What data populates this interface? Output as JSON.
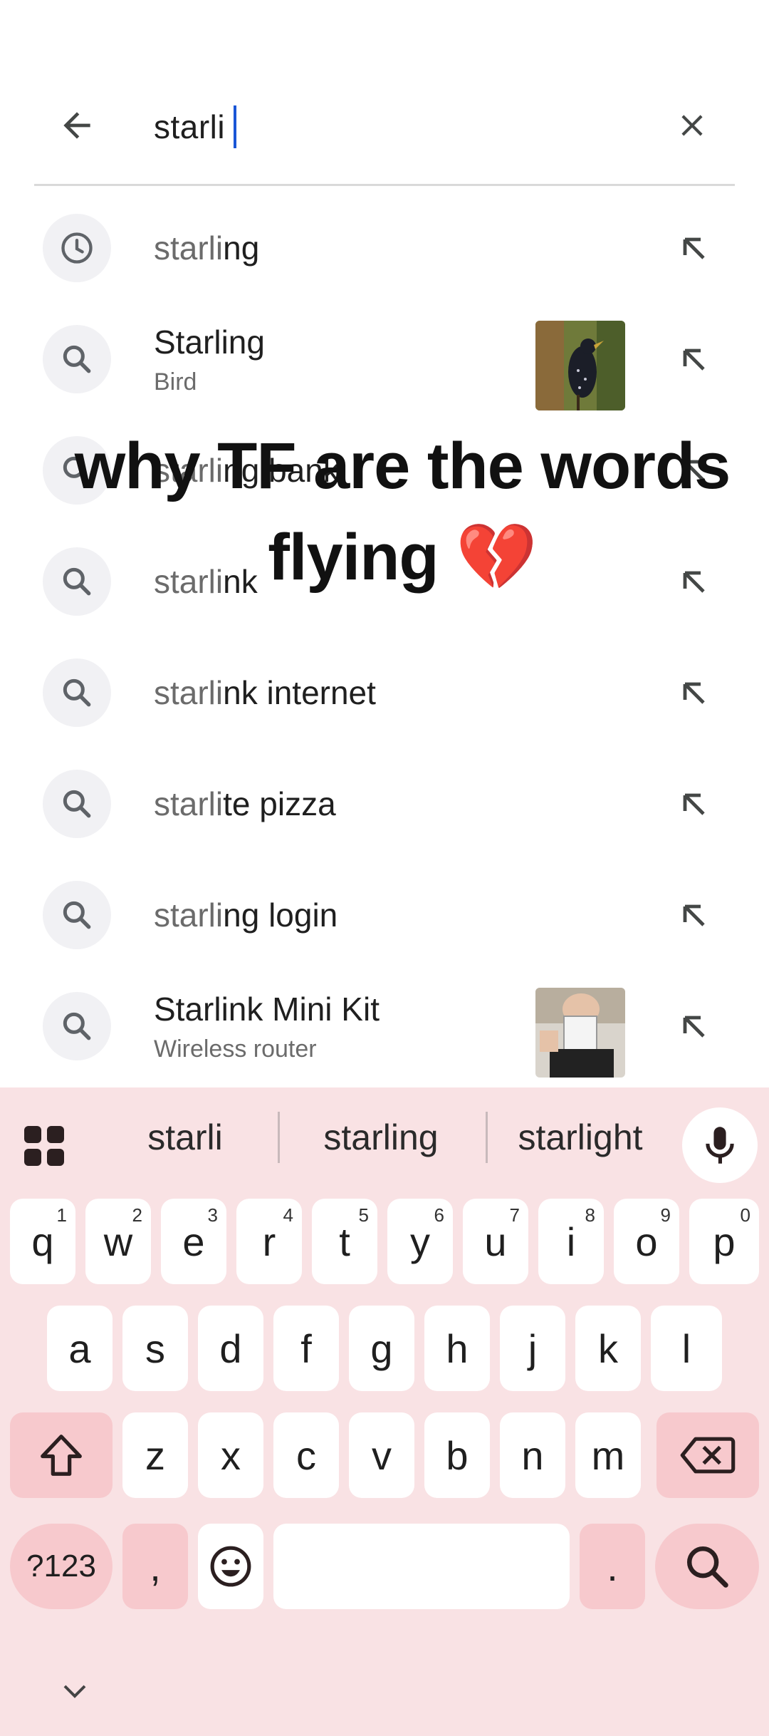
{
  "search": {
    "query": "starli",
    "back_icon": "arrow-back-icon",
    "clear_icon": "close-icon"
  },
  "suggestions": [
    {
      "type": "history",
      "icon": "history-icon",
      "typed": "starli",
      "rest": "ng"
    },
    {
      "type": "entity",
      "icon": "search-icon",
      "title": "Starling",
      "subtitle": "Bird",
      "thumb": "starling-bird-photo"
    },
    {
      "type": "query",
      "icon": "search-icon",
      "typed": "starli",
      "rest": "ng bank"
    },
    {
      "type": "query",
      "icon": "search-icon",
      "typed": "starli",
      "rest": "nk"
    },
    {
      "type": "query",
      "icon": "search-icon",
      "typed": "starli",
      "rest": "nk internet"
    },
    {
      "type": "query",
      "icon": "search-icon",
      "typed": "starli",
      "rest": "te pizza"
    },
    {
      "type": "query",
      "icon": "search-icon",
      "typed": "starli",
      "rest": "ng login"
    },
    {
      "type": "entity",
      "icon": "search-icon",
      "title": "Starlink Mini Kit",
      "subtitle": "Wireless router",
      "thumb": "router-kit-photo"
    }
  ],
  "overlay": {
    "line1": "why TF are the words",
    "line2": "flying 💔"
  },
  "keyboard": {
    "predictions": [
      "starli",
      "starling",
      "starlight"
    ],
    "row1": [
      {
        "k": "q",
        "h": "1"
      },
      {
        "k": "w",
        "h": "2"
      },
      {
        "k": "e",
        "h": "3"
      },
      {
        "k": "r",
        "h": "4"
      },
      {
        "k": "t",
        "h": "5"
      },
      {
        "k": "y",
        "h": "6"
      },
      {
        "k": "u",
        "h": "7"
      },
      {
        "k": "i",
        "h": "8"
      },
      {
        "k": "o",
        "h": "9"
      },
      {
        "k": "p",
        "h": "0"
      }
    ],
    "row2": [
      "a",
      "s",
      "d",
      "f",
      "g",
      "h",
      "j",
      "k",
      "l"
    ],
    "row3": [
      "z",
      "x",
      "c",
      "v",
      "b",
      "n",
      "m"
    ],
    "symbols_label": "?123",
    "comma": ",",
    "period": ".",
    "colors": {
      "bg": "#f9e2e4",
      "special": "#f7c9cd",
      "key": "#ffffff"
    }
  }
}
